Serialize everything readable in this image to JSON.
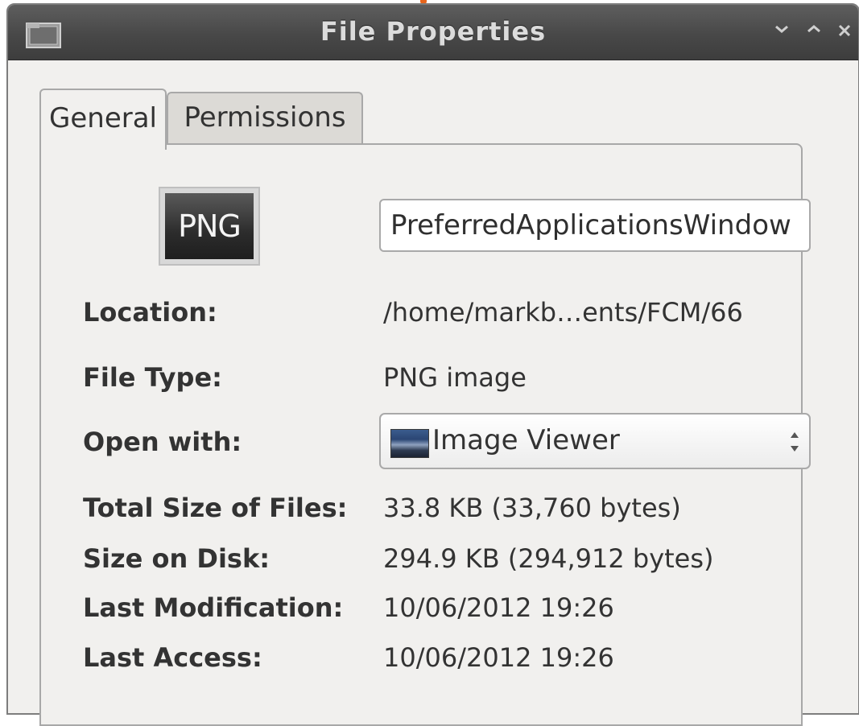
{
  "window": {
    "title": "File Properties",
    "controls": [
      "minimize",
      "maximize",
      "close"
    ]
  },
  "tabs": [
    {
      "label": "General",
      "active": true
    },
    {
      "label": "Permissions",
      "active": false
    }
  ],
  "file": {
    "icon_text": "PNG",
    "name": "PreferredApplicationsWindow"
  },
  "rows": {
    "location": {
      "label": "Location:",
      "value": "/home/markb…ents/FCM/66"
    },
    "file_type": {
      "label": "File Type:",
      "value": "PNG image"
    },
    "open_with": {
      "label": "Open with:",
      "value": "Image Viewer"
    },
    "total_size": {
      "label": "Total Size of Files:",
      "value": "33.8 KB (33,760 bytes)"
    },
    "size_on_disk": {
      "label": "Size on Disk:",
      "value": "294.9 KB (294,912 bytes)"
    },
    "last_modification": {
      "label": "Last Modification:",
      "value": "10/06/2012 19:26"
    },
    "last_access": {
      "label": "Last Access:",
      "value": "10/06/2012 19:26"
    }
  },
  "colors": {
    "titlebar": "#484848",
    "window_bg": "#f1f0ee",
    "accent_mark": "#e8651c"
  }
}
